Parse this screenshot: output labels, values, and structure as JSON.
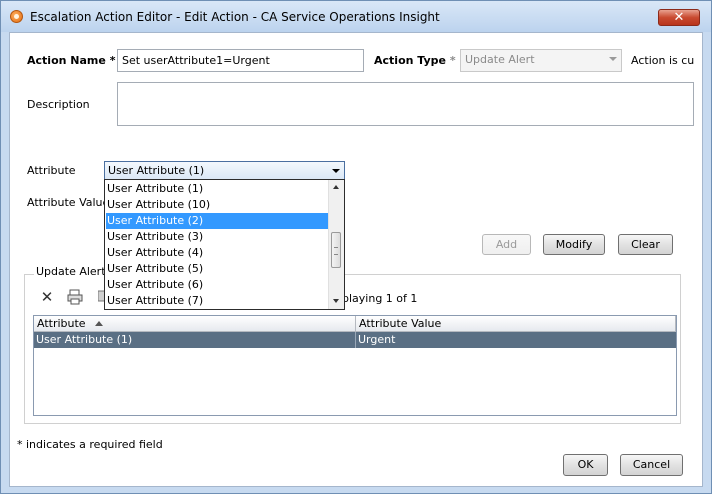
{
  "window": {
    "title": "Escalation Action Editor - Edit Action - CA Service Operations Insight",
    "close_label": "✕"
  },
  "form": {
    "action_name_label": "Action Name",
    "required_marker": "*",
    "action_name_value": "Set userAttribute1=Urgent",
    "action_type_label": "Action Type",
    "action_type_value": "Update Alert",
    "action_status_text": "Action is curr",
    "description_label": "Description",
    "description_value": "",
    "attribute_label": "Attribute",
    "attribute_selected": "User Attribute (1)",
    "attribute_value_label": "Attribute Value"
  },
  "attribute_dropdown": {
    "options": [
      "User Attribute (1)",
      "User Attribute (10)",
      "User Attribute (2)",
      "User Attribute (3)",
      "User Attribute (4)",
      "User Attribute (5)",
      "User Attribute (6)",
      "User Attribute (7)"
    ],
    "highlighted_index": 2
  },
  "buttons": {
    "add": "Add",
    "modify": "Modify",
    "clear": "Clear",
    "ok": "OK",
    "cancel": "Cancel"
  },
  "group": {
    "title": "Update Alert A",
    "displaying_text": "playing 1 of 1"
  },
  "table": {
    "columns": [
      "Attribute",
      "Attribute Value"
    ],
    "rows": [
      {
        "attribute": "User Attribute (1)",
        "value": "Urgent"
      }
    ]
  },
  "footer": {
    "required_note": "* indicates a required field"
  },
  "colors": {
    "selection": "#3399ff",
    "row_selected": "#5a6f84"
  }
}
